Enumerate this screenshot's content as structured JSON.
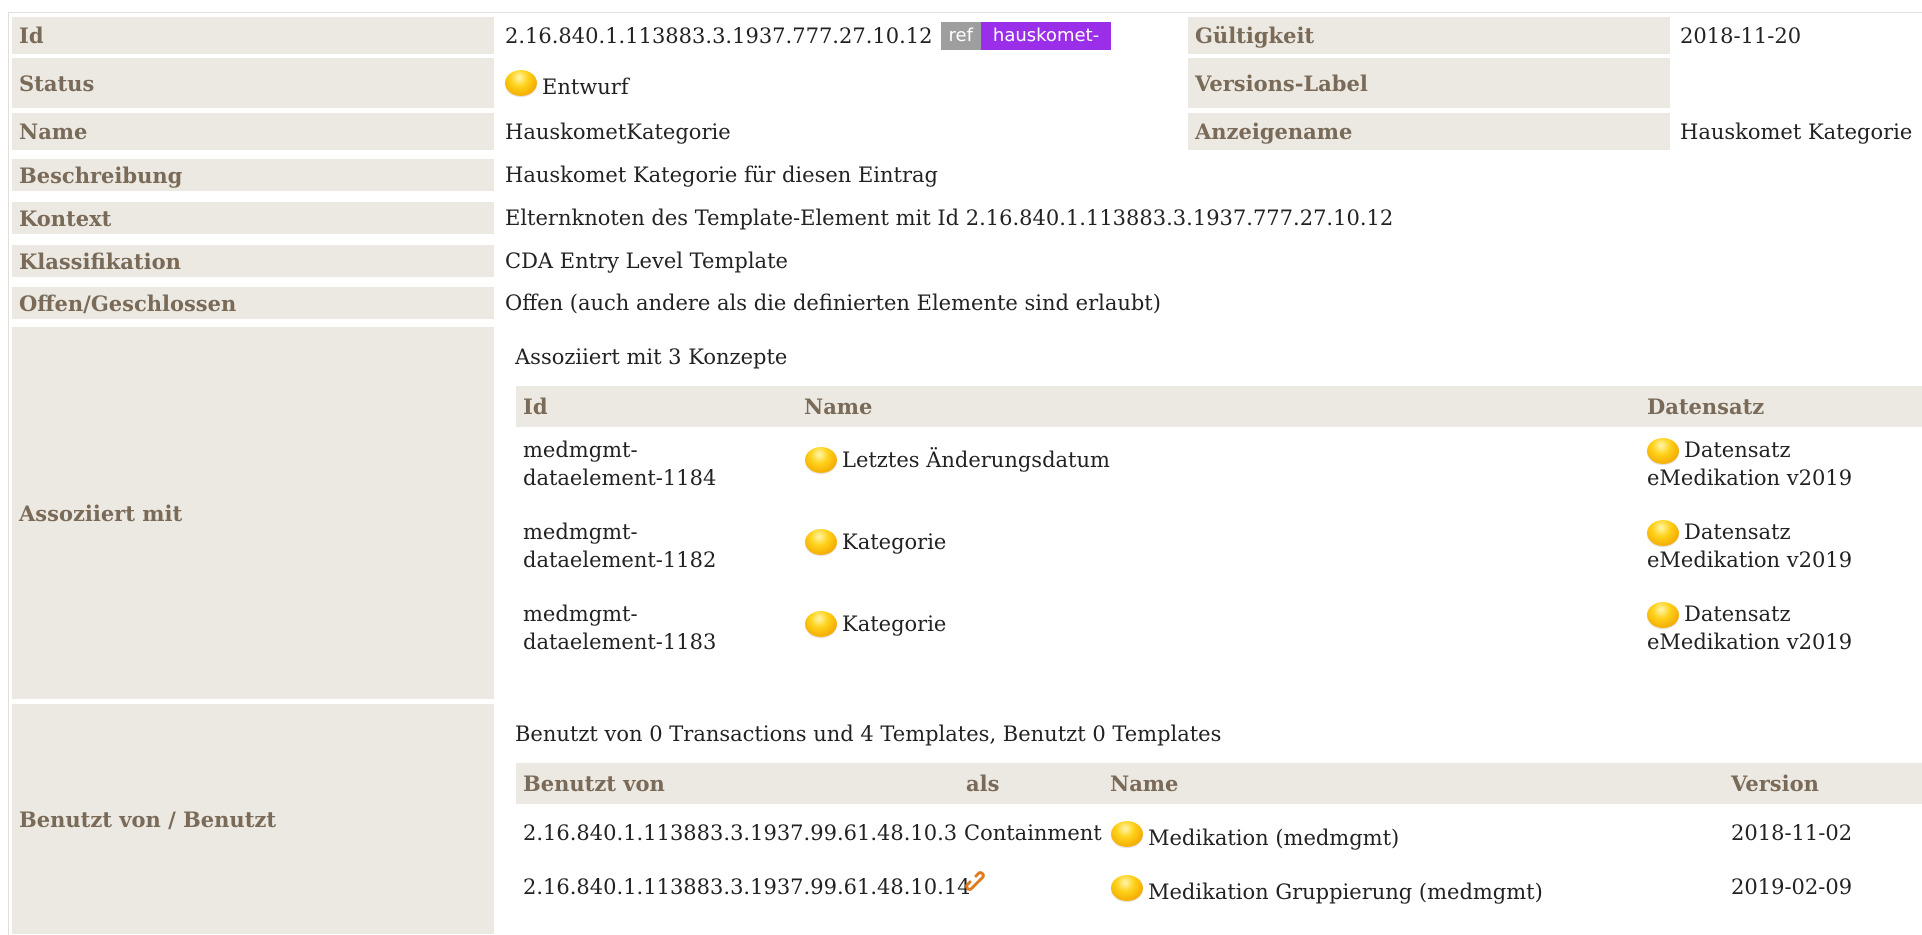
{
  "rows": {
    "id": {
      "label": "Id",
      "value": "2.16.840.1.113883.3.1937.777.27.10.12",
      "ref_badge": "ref",
      "prefix_badge": "hauskomet-"
    },
    "validity": {
      "label": "Gültigkeit",
      "value": "2018-11-20"
    },
    "status": {
      "label": "Status",
      "value": "Entwurf"
    },
    "version_label": {
      "label": "Versions-Label",
      "value": ""
    },
    "name": {
      "label": "Name",
      "value": "HauskometKategorie"
    },
    "display_name": {
      "label": "Anzeigename",
      "value": "Hauskomet Kategorie"
    },
    "description": {
      "label": "Beschreibung",
      "value": "Hauskomet Kategorie für diesen Eintrag"
    },
    "context": {
      "label": "Kontext",
      "value": "Elternknoten des Template-Element mit Id 2.16.840.1.113883.3.1937.777.27.10.12"
    },
    "classification": {
      "label": "Klassifikation",
      "value": "CDA Entry Level Template"
    },
    "open_closed": {
      "label": "Offen/Geschlossen",
      "value": "Offen (auch andere als die definierten Elemente sind erlaubt)"
    }
  },
  "associated": {
    "label": "Assoziiert mit",
    "caption": "Assoziiert mit 3 Konzepte",
    "headers": {
      "id": "Id",
      "name": "Name",
      "dataset": "Datensatz"
    },
    "items": [
      {
        "id_line1": "medmgmt-",
        "id_line2": "dataelement-1184",
        "name": "Letztes Änderungsdatum",
        "dataset_line1": "Datensatz",
        "dataset_line2": "eMedikation v2019"
      },
      {
        "id_line1": "medmgmt-",
        "id_line2": "dataelement-1182",
        "name": "Kategorie",
        "dataset_line1": "Datensatz",
        "dataset_line2": "eMedikation v2019"
      },
      {
        "id_line1": "medmgmt-",
        "id_line2": "dataelement-1183",
        "name": "Kategorie",
        "dataset_line1": "Datensatz",
        "dataset_line2": "eMedikation v2019"
      }
    ]
  },
  "used_by": {
    "label": "Benutzt von / Benutzt",
    "caption": "Benutzt von 0 Transactions und 4 Templates, Benutzt 0 Templates",
    "headers": {
      "used_by": "Benutzt von",
      "as": "als",
      "name": "Name",
      "version": "Version"
    },
    "items": [
      {
        "used_by": "2.16.840.1.113883.3.1937.99.61.48.10.3",
        "as": "Containment",
        "name": "Medikation (medmgmt)",
        "version": "2018-11-02"
      },
      {
        "used_by": "2.16.840.1.113883.3.1937.99.61.48.10.14",
        "as": "",
        "as_icon": "link-icon",
        "name": "Medikation Gruppierung (medmgmt)",
        "version": "2019-02-09"
      }
    ]
  },
  "colors": {
    "label_bg": "#ece9e3",
    "label_text": "#7a6a58",
    "status_ball": "#ffc107",
    "prefix_badge": "#9b2ee8",
    "ref_badge": "#9e9e9e"
  }
}
